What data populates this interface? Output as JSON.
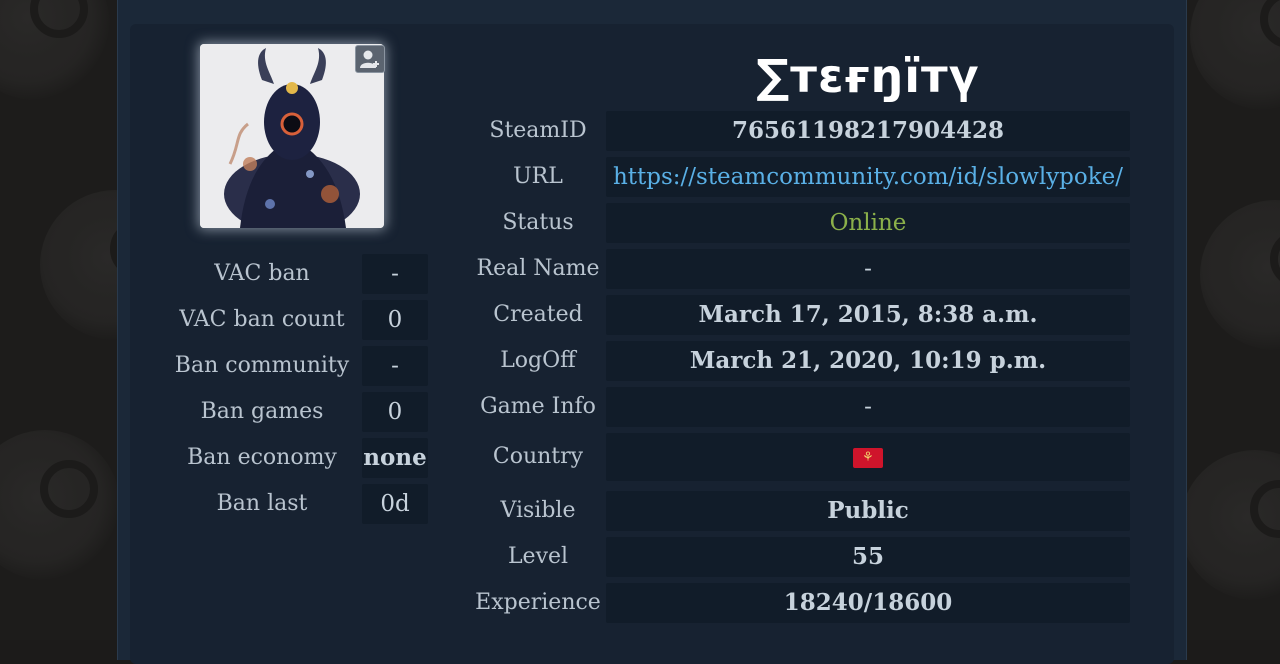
{
  "profile": {
    "name": "∑тɛғŋїтү",
    "avatar_alt": "avatar-image"
  },
  "bans": [
    {
      "label": "VAC ban",
      "value": "-"
    },
    {
      "label": "VAC ban count",
      "value": "0"
    },
    {
      "label": "Ban community",
      "value": "-"
    },
    {
      "label": "Ban games",
      "value": "0"
    },
    {
      "label": "Ban economy",
      "value": "none"
    },
    {
      "label": "Ban last",
      "value": "0d"
    }
  ],
  "info": {
    "steamid": {
      "label": "SteamID",
      "value": "76561198217904428"
    },
    "url": {
      "label": "URL",
      "value": "https://steamcommunity.com/id/slowlypoke/"
    },
    "status": {
      "label": "Status",
      "value": "Online"
    },
    "realname": {
      "label": "Real Name",
      "value": "-"
    },
    "created": {
      "label": "Created",
      "value": "March 17, 2015, 8:38 a.m."
    },
    "logoff": {
      "label": "LogOff",
      "value": "March 21, 2020, 10:19 p.m."
    },
    "gameinfo": {
      "label": "Game Info",
      "value": "-"
    },
    "country": {
      "label": "Country",
      "flag_icon": "isle-of-man-flag-icon"
    },
    "visible": {
      "label": "Visible",
      "value": "Public"
    },
    "level": {
      "label": "Level",
      "value": "55"
    },
    "experience": {
      "label": "Experience",
      "value": "18240/18600"
    }
  },
  "colors": {
    "link": "#5ab0e6",
    "online": "#8bb04a",
    "panel": "#172231",
    "value_bg": "#111c29"
  }
}
